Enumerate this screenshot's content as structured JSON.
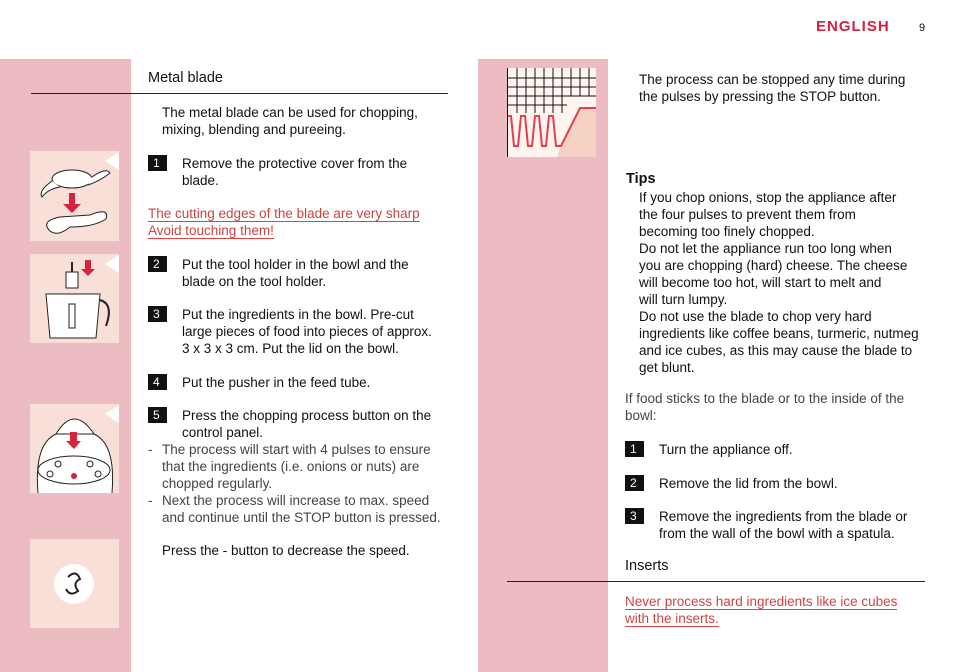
{
  "header": {
    "language": "ENGLISH",
    "page_number": "9",
    "accent_color": "#d6213f"
  },
  "left": {
    "heading": "Metal blade",
    "intro": [
      "The metal blade can be used for chopping,",
      "mixing, blending and pureeing."
    ],
    "step1": {
      "num": "1",
      "lines": [
        "Remove the protective cover from the",
        "blade."
      ]
    },
    "warning": [
      "The cutting edges of the blade are very sharp",
      "Avoid touching them!"
    ],
    "step2": {
      "num": "2",
      "lines": [
        "Put the tool holder in the bowl and the",
        "blade on the tool holder."
      ]
    },
    "step3": {
      "num": "3",
      "lines": [
        "Put the ingredients in the bowl. Pre-cut",
        "large pieces of food into pieces of approx.",
        "3 x 3 x 3 cm. Put the lid on the bowl."
      ]
    },
    "step4": {
      "num": "4",
      "lines": [
        "Put the pusher in the feed tube."
      ]
    },
    "step5": {
      "num": "5",
      "lines": [
        "Press the chopping process button on the",
        "control panel."
      ]
    },
    "bullets": [
      [
        "-",
        "The process will start with 4 pulses to ensure",
        "that the ingredients (i.e. onions or nuts) are",
        "chopped regularly."
      ],
      [
        "-",
        "Next the process will increase to max. speed",
        "and continue until the STOP button is pressed."
      ]
    ],
    "speed_note": "Press the - button to decrease the speed."
  },
  "right": {
    "stop_note": [
      "The process can be stopped any time during",
      "the pulses by pressing the STOP button."
    ],
    "tips_heading": "Tips",
    "tips": [
      "If you chop onions, stop the appliance after",
      "the four pulses to prevent them from",
      "becoming too finely chopped.",
      "Do not let the appliance run too long when",
      "you are chopping (hard) cheese. The cheese",
      "will become too hot, will start to melt and",
      "will turn lumpy.",
      "Do not use the blade to chop very hard",
      "ingredients like coffee beans, turmeric, nutmeg",
      "and ice cubes, as this may cause the blade to",
      "get blunt."
    ],
    "stick_note": [
      "If food sticks to the blade or to the inside of the",
      "bowl:"
    ],
    "step1": {
      "num": "1",
      "lines": [
        "Turn the appliance off."
      ]
    },
    "step2": {
      "num": "2",
      "lines": [
        "Remove the lid from the bowl."
      ]
    },
    "step3": {
      "num": "3",
      "lines": [
        "Remove the ingredients from the blade or",
        "from the wall of the bowl with a spatula."
      ]
    },
    "inserts_heading": "Inserts",
    "inserts_warning": [
      "Never process hard ingredients like ice cubes",
      "with the inserts."
    ]
  }
}
